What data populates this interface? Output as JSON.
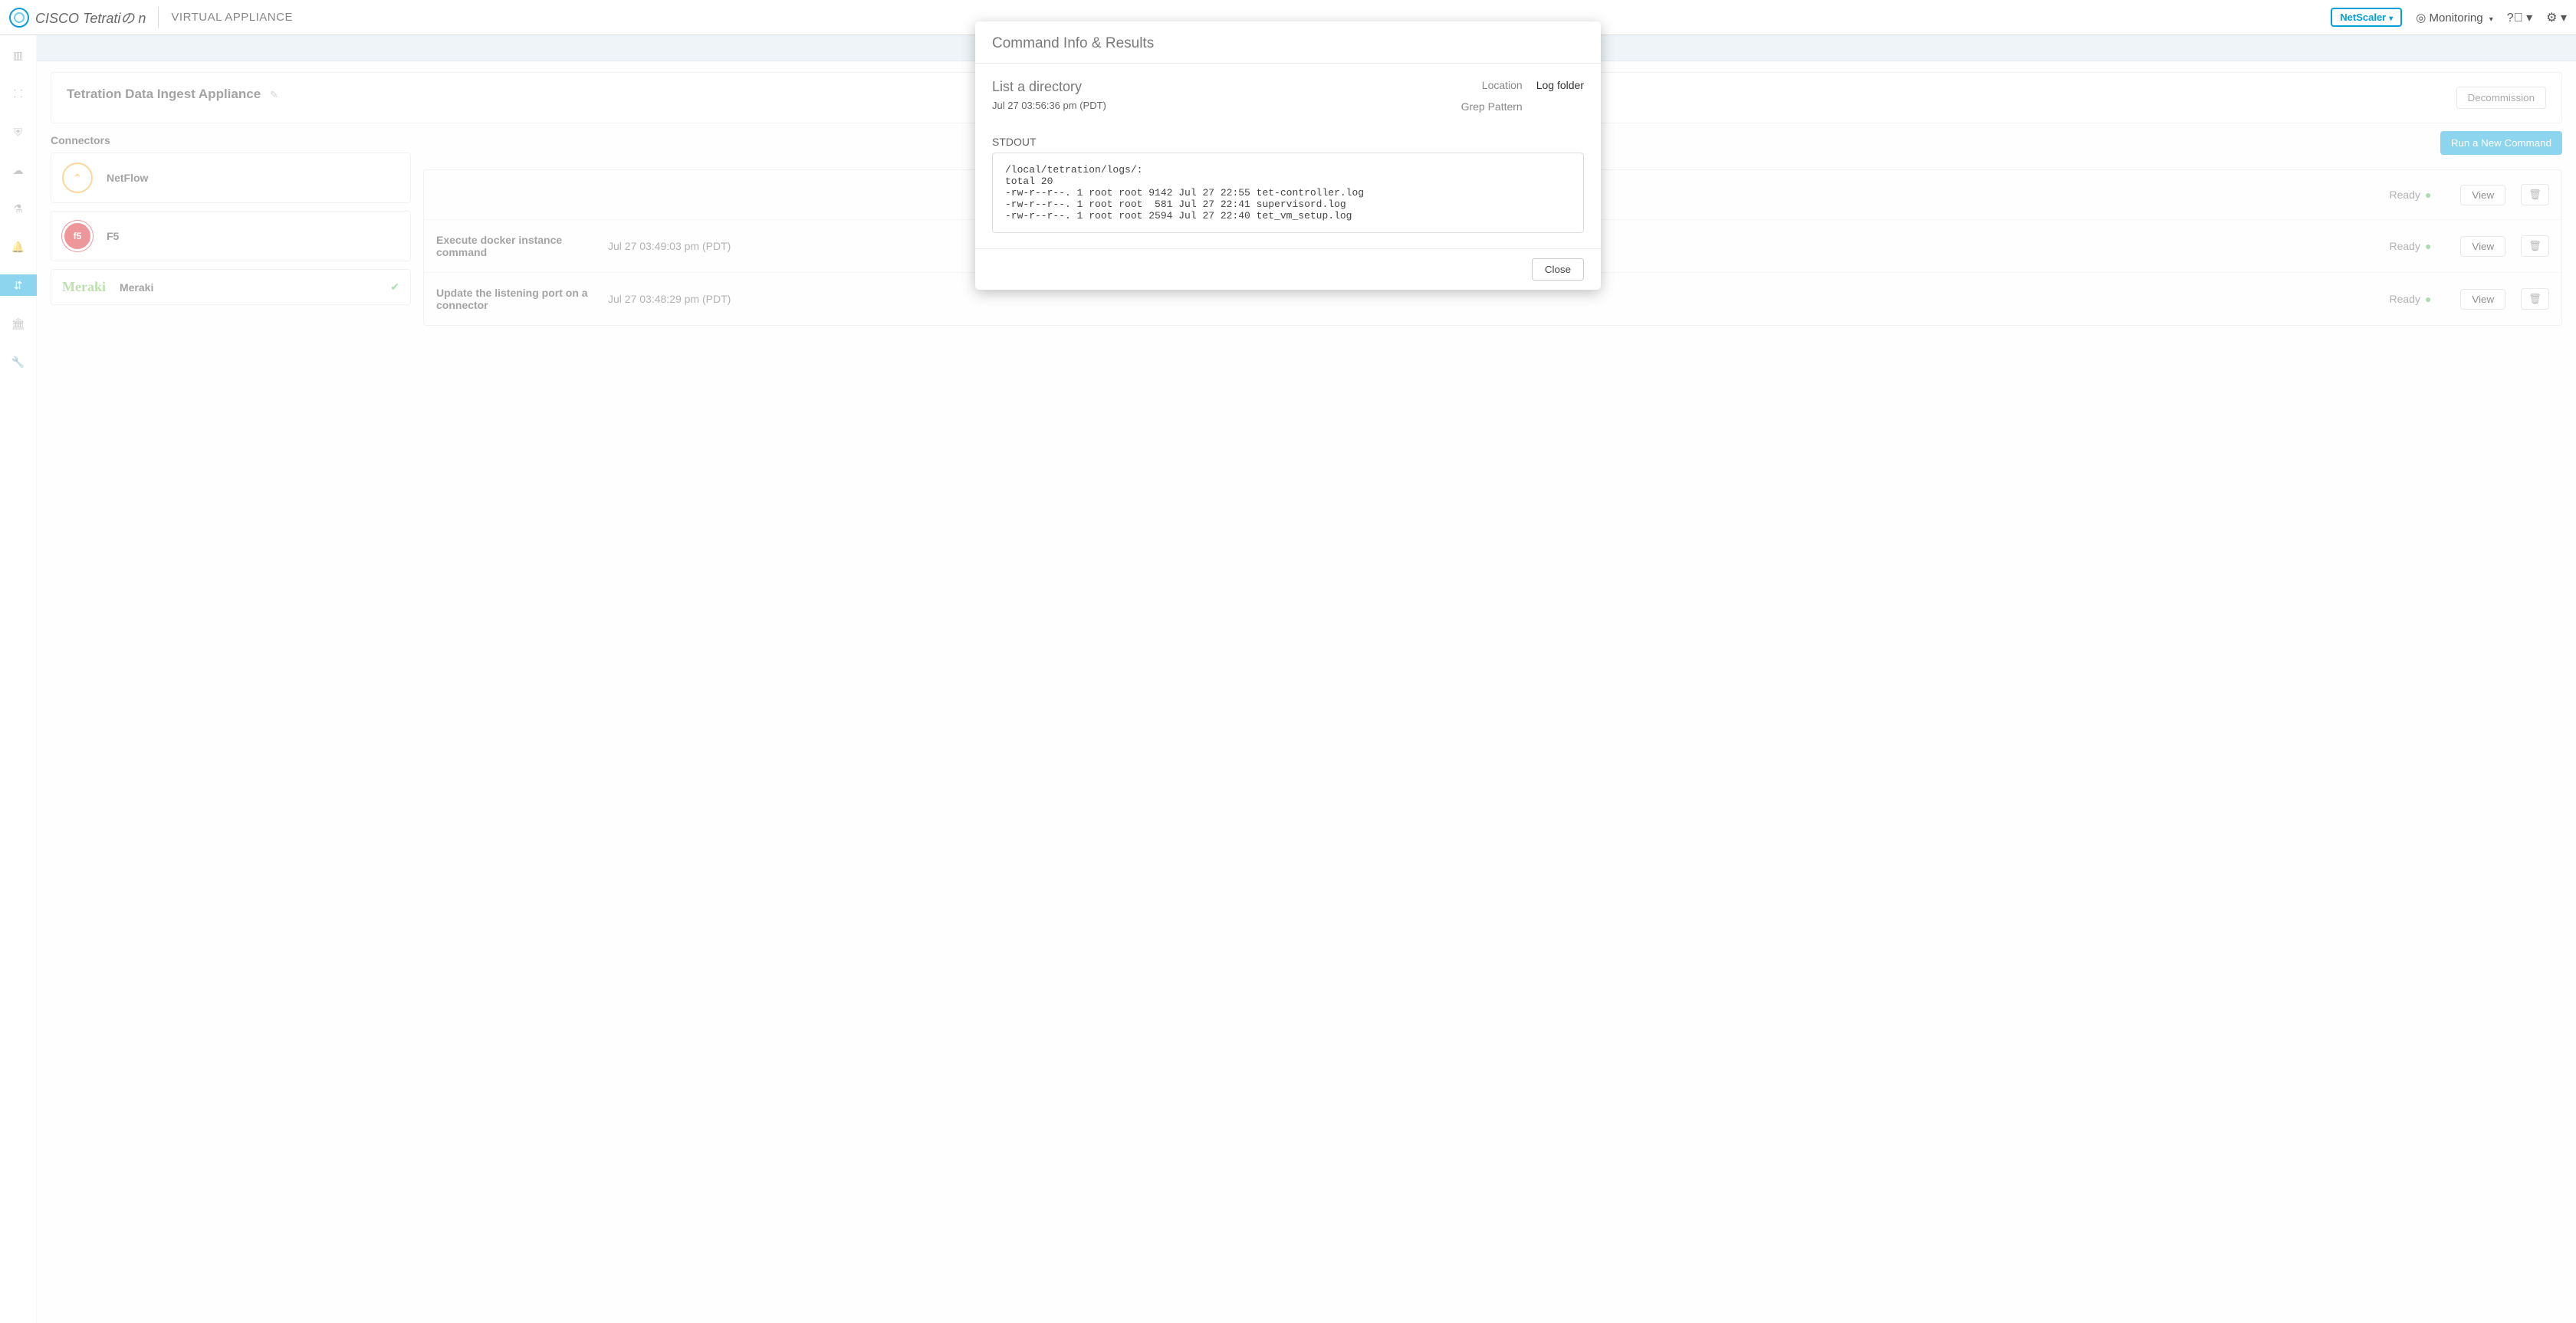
{
  "topbar": {
    "brand": "CISCO Tetratiの n",
    "subtitle": "VIRTUAL APPLIANCE",
    "scope": "NetScaler",
    "monitoring": "Monitoring"
  },
  "page": {
    "appliance_title": "Tetration Data Ingest Appliance",
    "decommission": "Decommission",
    "connectors_label": "Connectors",
    "run_new_cmd": "Run a New Command"
  },
  "connectors": [
    {
      "name": "NetFlow"
    },
    {
      "name": "F5"
    },
    {
      "name": "Meraki"
    }
  ],
  "commands": [
    {
      "name": "",
      "date": "",
      "status": "Ready",
      "view": "View"
    },
    {
      "name": "Execute docker instance command",
      "date": "Jul 27 03:49:03 pm (PDT)",
      "status": "Ready",
      "view": "View"
    },
    {
      "name": "Update the listening port on a connector",
      "date": "Jul 27 03:48:29 pm (PDT)",
      "status": "Ready",
      "view": "View"
    }
  ],
  "modal": {
    "title": "Command Info & Results",
    "cmd": "List a directory",
    "ts": "Jul 27 03:56:36 pm (PDT)",
    "location_label": "Location",
    "location_value": "Log folder",
    "grep_label": "Grep Pattern",
    "stdout_label": "STDOUT",
    "stdout": "/local/tetration/logs/:\ntotal 20\n-rw-r--r--. 1 root root 9142 Jul 27 22:55 tet-controller.log\n-rw-r--r--. 1 root root  581 Jul 27 22:41 supervisord.log\n-rw-r--r--. 1 root root 2594 Jul 27 22:40 tet_vm_setup.log",
    "close": "Close"
  },
  "chart_data": {
    "type": "table",
    "note": "no chart in image"
  }
}
